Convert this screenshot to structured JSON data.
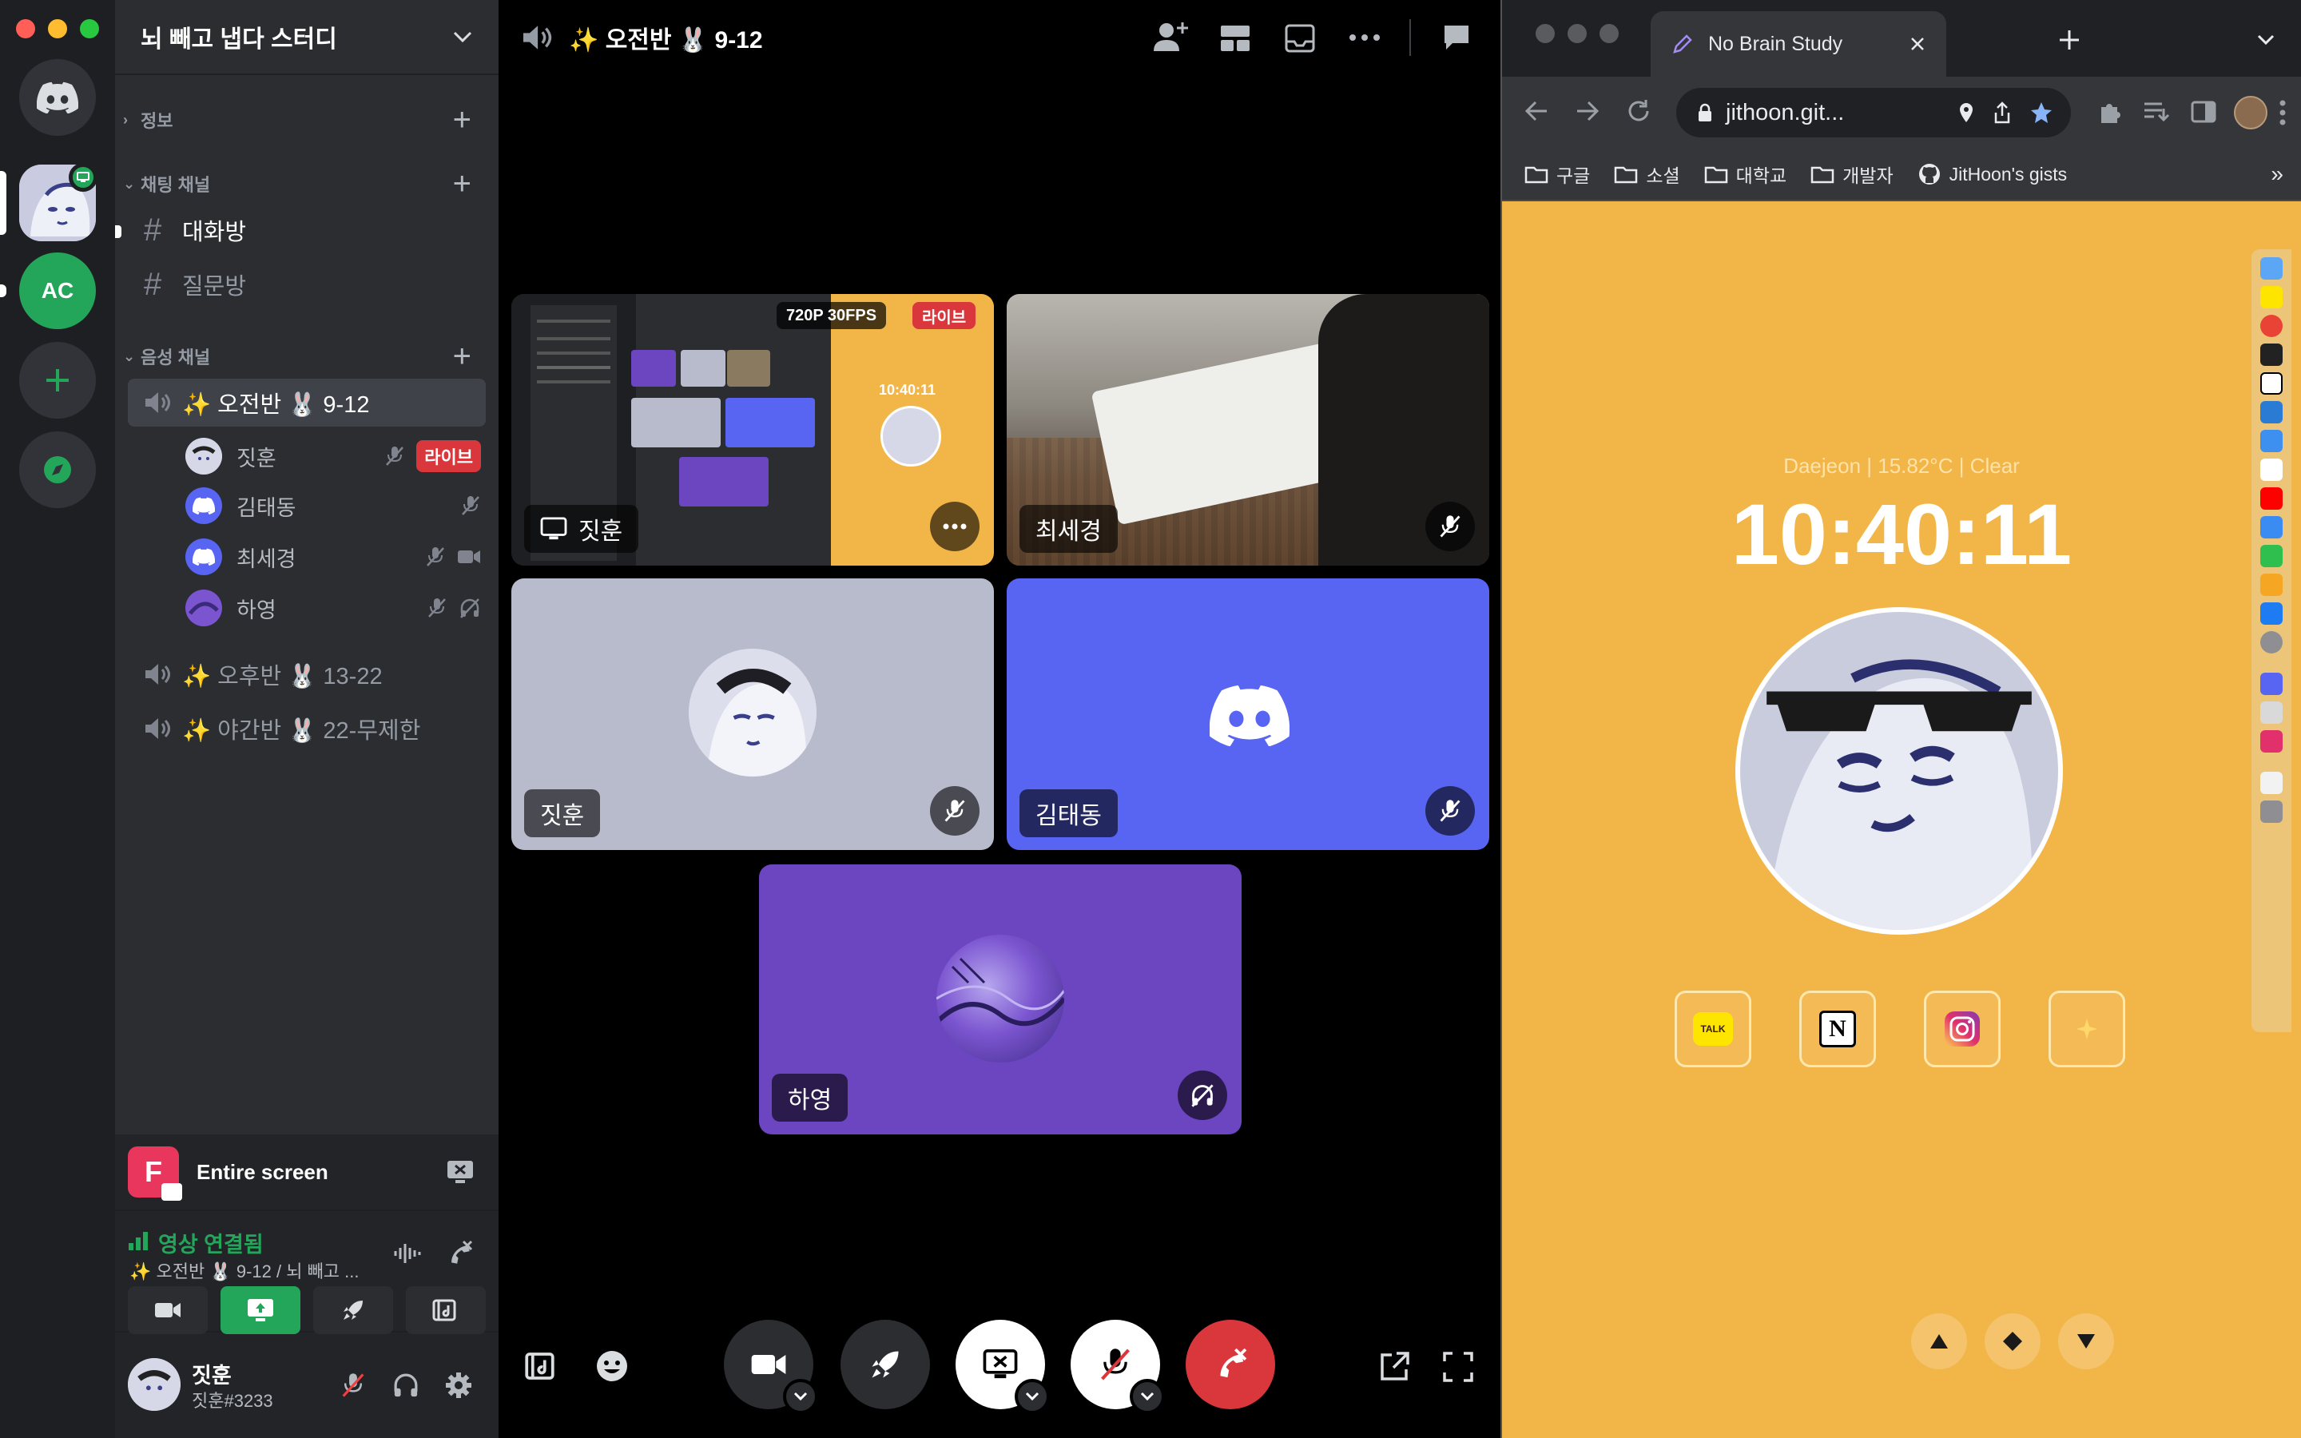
{
  "discord": {
    "server_rail": {
      "servers": [
        {
          "name": "home",
          "icon": "discord-logo-icon"
        },
        {
          "name": "study-server",
          "icon": "avatar-icon"
        },
        {
          "name": "ac-server",
          "label": "AC"
        },
        {
          "name": "add-server",
          "icon": "plus-icon"
        },
        {
          "name": "explore",
          "icon": "compass-icon"
        }
      ]
    },
    "guild": {
      "name": "뇌 빼고 냅다 스터디",
      "categories": {
        "info": "정보",
        "text": "채팅 채널",
        "voice": "음성 채널"
      },
      "text_channels": [
        "대화방",
        "질문방"
      ],
      "voice_channels": [
        {
          "name": "✨ 오전반 🐰 9-12"
        },
        {
          "name": "✨ 오후반 🐰 13-22"
        },
        {
          "name": "✨ 야간반 🐰 22-무제한"
        }
      ],
      "members": [
        {
          "name": "짓훈",
          "live": "라이브"
        },
        {
          "name": "김태동"
        },
        {
          "name": "최세경"
        },
        {
          "name": "하영"
        }
      ]
    },
    "panels": {
      "screen_share": "Entire screen",
      "screen_icon_letter": "F",
      "connection_status": "영상 연결됨",
      "connection_channel": "✨ 오전반 🐰 9-12 / 뇌 빼고 ...",
      "user": {
        "name": "짓훈",
        "tag": "짓훈#3233"
      }
    },
    "stage": {
      "title": "✨ 오전반 🐰 9-12",
      "tiles": [
        {
          "label": "짓훈",
          "quality": "720P 30FPS",
          "live": "라이브"
        },
        {
          "label": "최세경"
        },
        {
          "label": "짓훈"
        },
        {
          "label": "김태동"
        },
        {
          "label": "하영"
        }
      ],
      "mini_clock": "10:40:11"
    },
    "colors": {
      "blurple": "#5865f2",
      "green": "#23a55a",
      "red": "#da373c",
      "purple_tile": "#6c45c1",
      "grey_tile": "#b8bbcc"
    }
  },
  "chrome": {
    "tab_title": "No Brain Study",
    "url": "jithoon.git...",
    "bookmarks": [
      "구글",
      "소셜",
      "대학교",
      "개발자",
      "JitHoon's gists"
    ],
    "page": {
      "weather": "Daejeon | 15.82°C | Clear",
      "clock": "10:40:11",
      "apps": [
        "kakaotalk-icon",
        "notion-icon",
        "instagram-icon",
        "sparkle-icon"
      ],
      "kakao_label": "TALK",
      "notion_label": "N",
      "nav": [
        "up-icon",
        "diamond-icon",
        "down-icon"
      ]
    }
  }
}
